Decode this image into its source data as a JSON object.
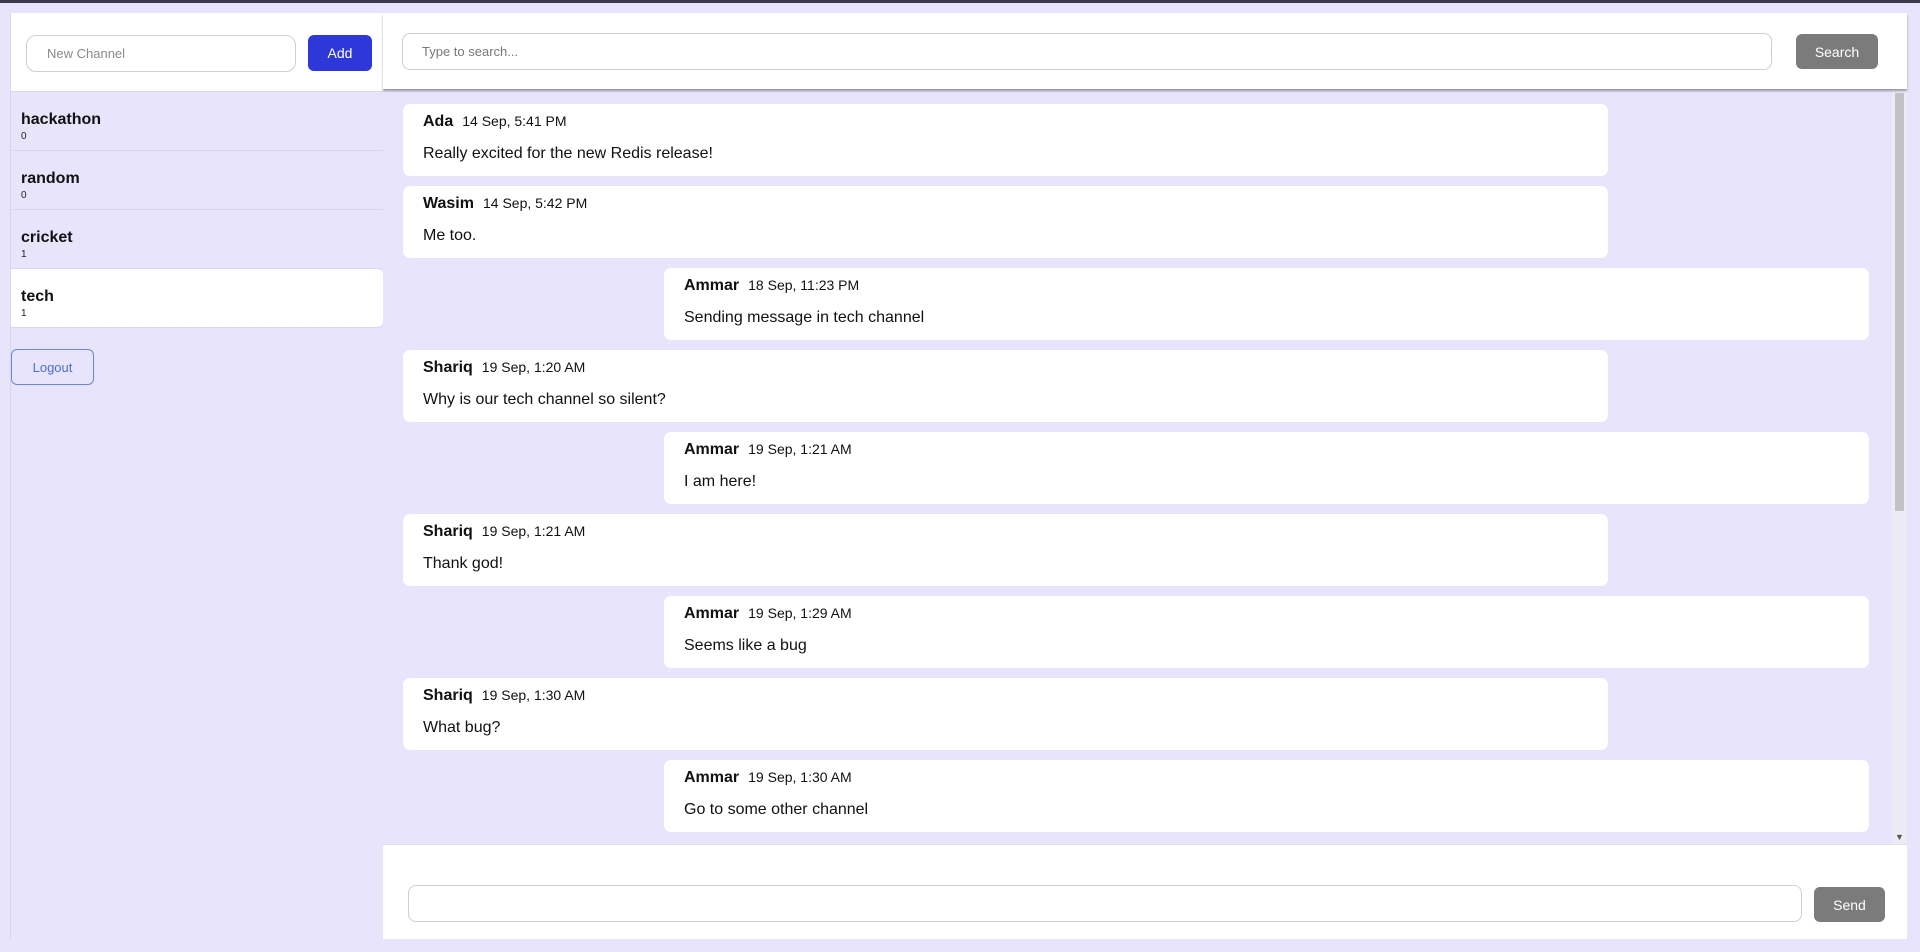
{
  "sidebar": {
    "new_channel_placeholder": "New Channel",
    "add_label": "Add",
    "channels": [
      {
        "name": "hackathon",
        "count": "0"
      },
      {
        "name": "random",
        "count": "0"
      },
      {
        "name": "cricket",
        "count": "1"
      },
      {
        "name": "tech",
        "count": "1"
      }
    ],
    "active_channel": "tech",
    "logout_label": "Logout"
  },
  "search": {
    "placeholder": "Type to search...",
    "button_label": "Search"
  },
  "messages": [
    {
      "author": "Ada",
      "time": "14 Sep, 5:41 PM",
      "text": "Really excited for the new Redis release!",
      "side": "left"
    },
    {
      "author": "Wasim",
      "time": "14 Sep, 5:42 PM",
      "text": "Me too.",
      "side": "left"
    },
    {
      "author": "Ammar",
      "time": "18 Sep, 11:23 PM",
      "text": "Sending message in tech channel",
      "side": "right"
    },
    {
      "author": "Shariq",
      "time": "19 Sep, 1:20 AM",
      "text": "Why is our tech channel so silent?",
      "side": "left"
    },
    {
      "author": "Ammar",
      "time": "19 Sep, 1:21 AM",
      "text": "I am here!",
      "side": "right"
    },
    {
      "author": "Shariq",
      "time": "19 Sep, 1:21 AM",
      "text": "Thank god!",
      "side": "left"
    },
    {
      "author": "Ammar",
      "time": "19 Sep, 1:29 AM",
      "text": "Seems like a bug",
      "side": "right"
    },
    {
      "author": "Shariq",
      "time": "19 Sep, 1:30 AM",
      "text": "What bug?",
      "side": "left"
    },
    {
      "author": "Ammar",
      "time": "19 Sep, 1:30 AM",
      "text": "Go to some other channel",
      "side": "right"
    }
  ],
  "composer": {
    "value": "",
    "send_label": "Send"
  },
  "colors": {
    "background": "#e7e4fc",
    "add_button": "#2e37d8",
    "search_button": "#7b7b7b",
    "logout_border": "#6b86d8"
  }
}
